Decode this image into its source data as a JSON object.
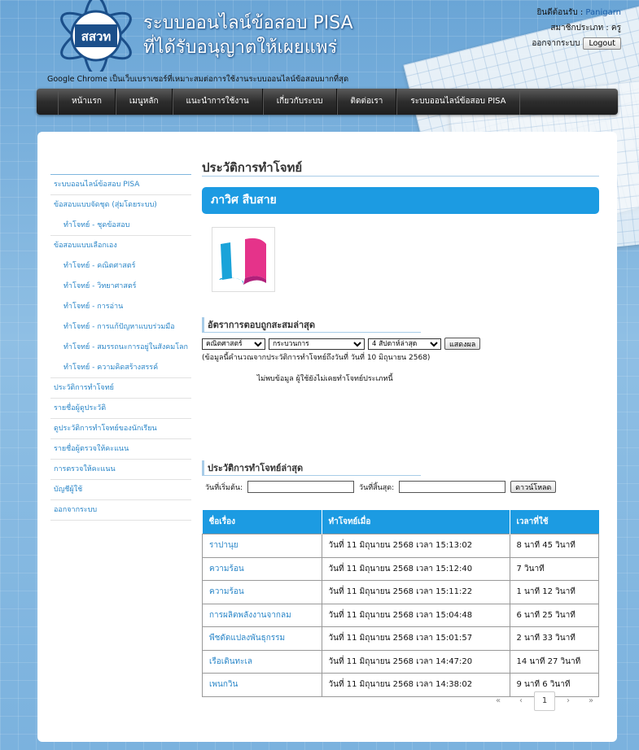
{
  "header": {
    "title_line1": "ระบบออนไลน์ข้อสอบ PISA",
    "title_line2": "ที่ได้รับอนุญาตให้เผยแพร่",
    "logo_text": "สสวท",
    "browser_note": "Google Chrome เป็นเว็บเบราเซอร์ที่เหมาะสมต่อการใช้งานระบบออนไลน์ข้อสอบมากที่สุด",
    "welcome_label": "ยินดีต้อนรับ :",
    "username": "Panigarn",
    "member_type": "สมาชิกประเภท : ครู",
    "logout_label": "ออกจากระบบ",
    "logout_button": "Logout"
  },
  "nav": {
    "items": [
      "หน้าแรก",
      "เมนูหลัก",
      "แนะนำการใช้งาน",
      "เกี่ยวกับระบบ",
      "ติดต่อเรา",
      "ระบบออนไลน์ข้อสอบ PISA"
    ]
  },
  "sidebar": {
    "items": [
      "ระบบออนไลน์ข้อสอบ PISA",
      "ข้อสอบแบบจัดชุด (สุ่มโดยระบบ)",
      "ทำโจทย์ - ชุดข้อสอบ",
      "ข้อสอบแบบเลือกเอง",
      "ทำโจทย์ - คณิตศาสตร์",
      "ทำโจทย์ - วิทยาศาสตร์",
      "ทำโจทย์ - การอ่าน",
      "ทำโจทย์ - การแก้ปัญหาแบบร่วมมือ",
      "ทำโจทย์ - สมรรถนะการอยู่ในสังคมโลก",
      "ทำโจทย์ - ความคิดสร้างสรรค์",
      "ประวัติการทำโจทย์",
      "รายชื่อผู้ดูประวัติ",
      "ดูประวัติการทำโจทย์ของนักเรียน",
      "รายชื่อผู้ตรวจให้คะแนน",
      "การตรวจให้คะแนน",
      "บัญชีผู้ใช้",
      "ออกจากระบบ"
    ]
  },
  "main": {
    "page_title": "ประวัติการทำโจทย์",
    "student_name": "ภาวิศ สืบสาย"
  },
  "rate": {
    "title": "อัตราการตอบถูกสะสมล่าสุด",
    "subject_selected": "คณิตศาสตร์",
    "process_selected": "กระบวนการ",
    "period_selected": "4 สัปดาห์ล่าสุด",
    "show_button": "แสดงผล",
    "note": "(ข้อมูลนี้คำนวณจากประวัติการทำโจทย์ถึงวันที่ วันที่ 10 มิถุนายน 2568)",
    "nodata": "ไม่พบข้อมูล ผู้ใช้ยังไม่เคยทำโจทย์ประเภทนี้"
  },
  "history": {
    "title": "ประวัติการทำโจทย์ล่าสุด",
    "start_label": "วันที่เริ่มต้น:",
    "end_label": "วันที่สิ้นสุด:",
    "download_button": "ดาวน์โหลด",
    "columns": [
      "ชื่อเรื่อง",
      "ทำโจทย์เมื่อ",
      "เวลาที่ใช้"
    ],
    "rows": [
      [
        "ราปานุย",
        "วันที่ 11 มิถุนายน 2568 เวลา 15:13:02",
        "8 นาที 45 วินาที"
      ],
      [
        "ความร้อน",
        "วันที่ 11 มิถุนายน 2568 เวลา 15:12:40",
        "7 วินาที"
      ],
      [
        "ความร้อน",
        "วันที่ 11 มิถุนายน 2568 เวลา 15:11:22",
        "1 นาที 12 วินาที"
      ],
      [
        "การผลิตพลังงานจากลม",
        "วันที่ 11 มิถุนายน 2568 เวลา 15:04:48",
        "6 นาที 25 วินาที"
      ],
      [
        "พืชดัดแปลงพันธุกรรม",
        "วันที่ 11 มิถุนายน 2568 เวลา 15:01:57",
        "2 นาที 33 วินาที"
      ],
      [
        "เรือเดินทะเล",
        "วันที่ 11 มิถุนายน 2568 เวลา 14:47:20",
        "14 นาที 27 วินาที"
      ],
      [
        "เพนกวิน",
        "วันที่ 11 มิถุนายน 2568 เวลา 14:38:02",
        "9 นาที 6 วินาที"
      ]
    ]
  },
  "pager": {
    "first": "«",
    "prev": "‹",
    "current": "1",
    "next": "›",
    "last": "»"
  },
  "colors": {
    "accent": "#1c9be2",
    "link": "#2a86c8",
    "nav_bg": "#2d2d2d"
  }
}
